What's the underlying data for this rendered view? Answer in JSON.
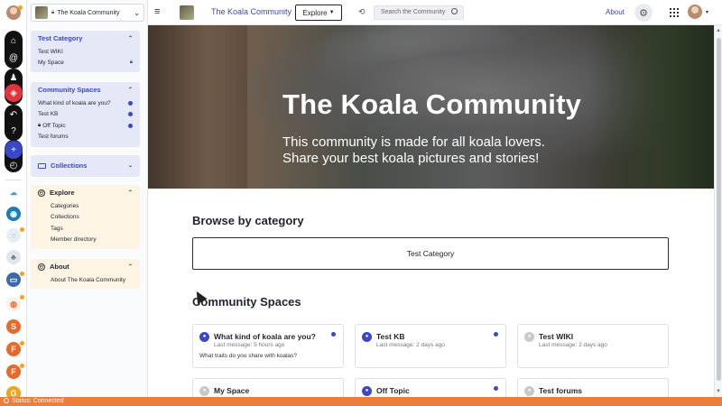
{
  "rail": {
    "apps": [
      {
        "name": "home",
        "icon": "home-icon",
        "glyph": "⌂"
      },
      {
        "name": "mentions",
        "icon": "at-icon",
        "glyph": "@"
      },
      {
        "name": "people",
        "icon": "users-icon",
        "glyph": "♟"
      },
      {
        "name": "tags",
        "icon": "tag-icon",
        "glyph": "◈"
      },
      {
        "name": "share",
        "icon": "share-icon",
        "glyph": "↶"
      },
      {
        "name": "help",
        "icon": "help-icon",
        "glyph": "?"
      },
      {
        "name": "add",
        "icon": "plus-icon",
        "glyph": "+"
      },
      {
        "name": "compass",
        "icon": "compass-icon",
        "glyph": "◴"
      }
    ],
    "accent": "#3a47c9",
    "status_color": "#f0a31b"
  },
  "status_bar": {
    "text": "Status: Connected",
    "color": "#ef7d3a"
  },
  "sidebar": {
    "community_switch": {
      "name": "The Koala Community"
    },
    "test_category": {
      "title": "Test Category",
      "items": [
        {
          "label": "Test WIKI"
        },
        {
          "label": "My Space"
        }
      ]
    },
    "community_spaces": {
      "title": "Community Spaces",
      "items": [
        {
          "label": "What kind of koala are you?"
        },
        {
          "label": "Test KB"
        },
        {
          "label": "Off Topic"
        },
        {
          "label": "Test forums"
        }
      ]
    },
    "collections": {
      "title": "Collections"
    },
    "explore": {
      "title": "Explore",
      "items": [
        {
          "label": "Categories"
        },
        {
          "label": "Collections"
        },
        {
          "label": "Tags"
        },
        {
          "label": "Member directory"
        }
      ]
    },
    "about": {
      "title": "About",
      "items": [
        {
          "label": "About The Koala Community"
        }
      ]
    }
  },
  "topbar": {
    "title": "The Koala Community",
    "explore_label": "Explore",
    "search_placeholder": "Search the Community",
    "about_label": "About"
  },
  "hero": {
    "title": "The Koala Community",
    "subtitle": "This community is made for all koala lovers. Share your best koala pictures and stories!"
  },
  "browse": {
    "heading": "Browse by category",
    "categories": [
      {
        "label": "Test Category"
      }
    ]
  },
  "spaces": {
    "heading": "Community Spaces",
    "cards": [
      {
        "title": "What kind of koala are you?",
        "meta": "Last message: 5 hours ago",
        "desc": "What traits do you share with koalas?"
      },
      {
        "title": "Test KB",
        "meta": "Last message: 2 days ago"
      },
      {
        "title": "Test WIKI",
        "meta": "Last message: 2 days ago"
      },
      {
        "title": "My Space"
      },
      {
        "title": "Off Topic"
      },
      {
        "title": "Test forums"
      }
    ]
  }
}
